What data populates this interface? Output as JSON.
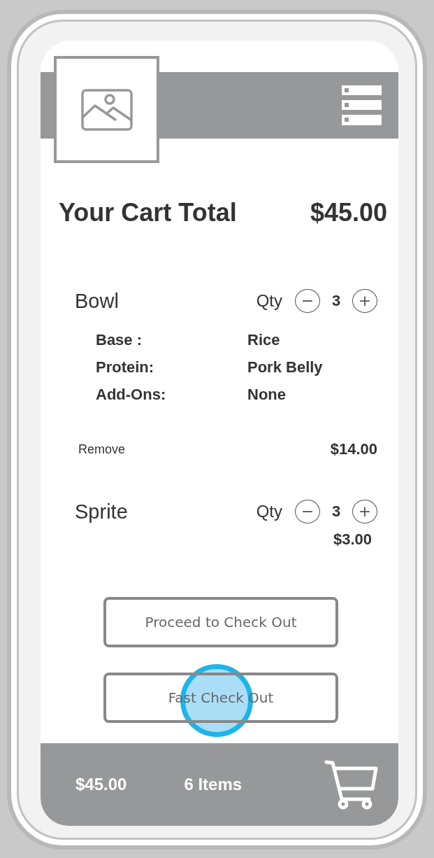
{
  "cart_total": {
    "label": "Your Cart Total",
    "amount": "$45.00"
  },
  "items": [
    {
      "name": "Bowl",
      "qty_label": "Qty",
      "qty": "3",
      "decrease": "−",
      "increase": "+",
      "options": [
        {
          "label": "Base :",
          "value": "Rice"
        },
        {
          "label": "Protein:",
          "value": "Pork Belly"
        },
        {
          "label": "Add-Ons:",
          "value": "None"
        }
      ],
      "remove": "Remove",
      "price": "$14.00"
    },
    {
      "name": "Sprite",
      "qty_label": "Qty",
      "qty": "3",
      "decrease": "−",
      "increase": "+",
      "price": "$3.00"
    }
  ],
  "buttons": [
    {
      "label": "Proceed to Check Out",
      "tapped": false
    },
    {
      "label": "Fast Check Out",
      "tapped": true
    }
  ],
  "bottom_bar": {
    "total": "$45.00",
    "count": "6 Items"
  }
}
